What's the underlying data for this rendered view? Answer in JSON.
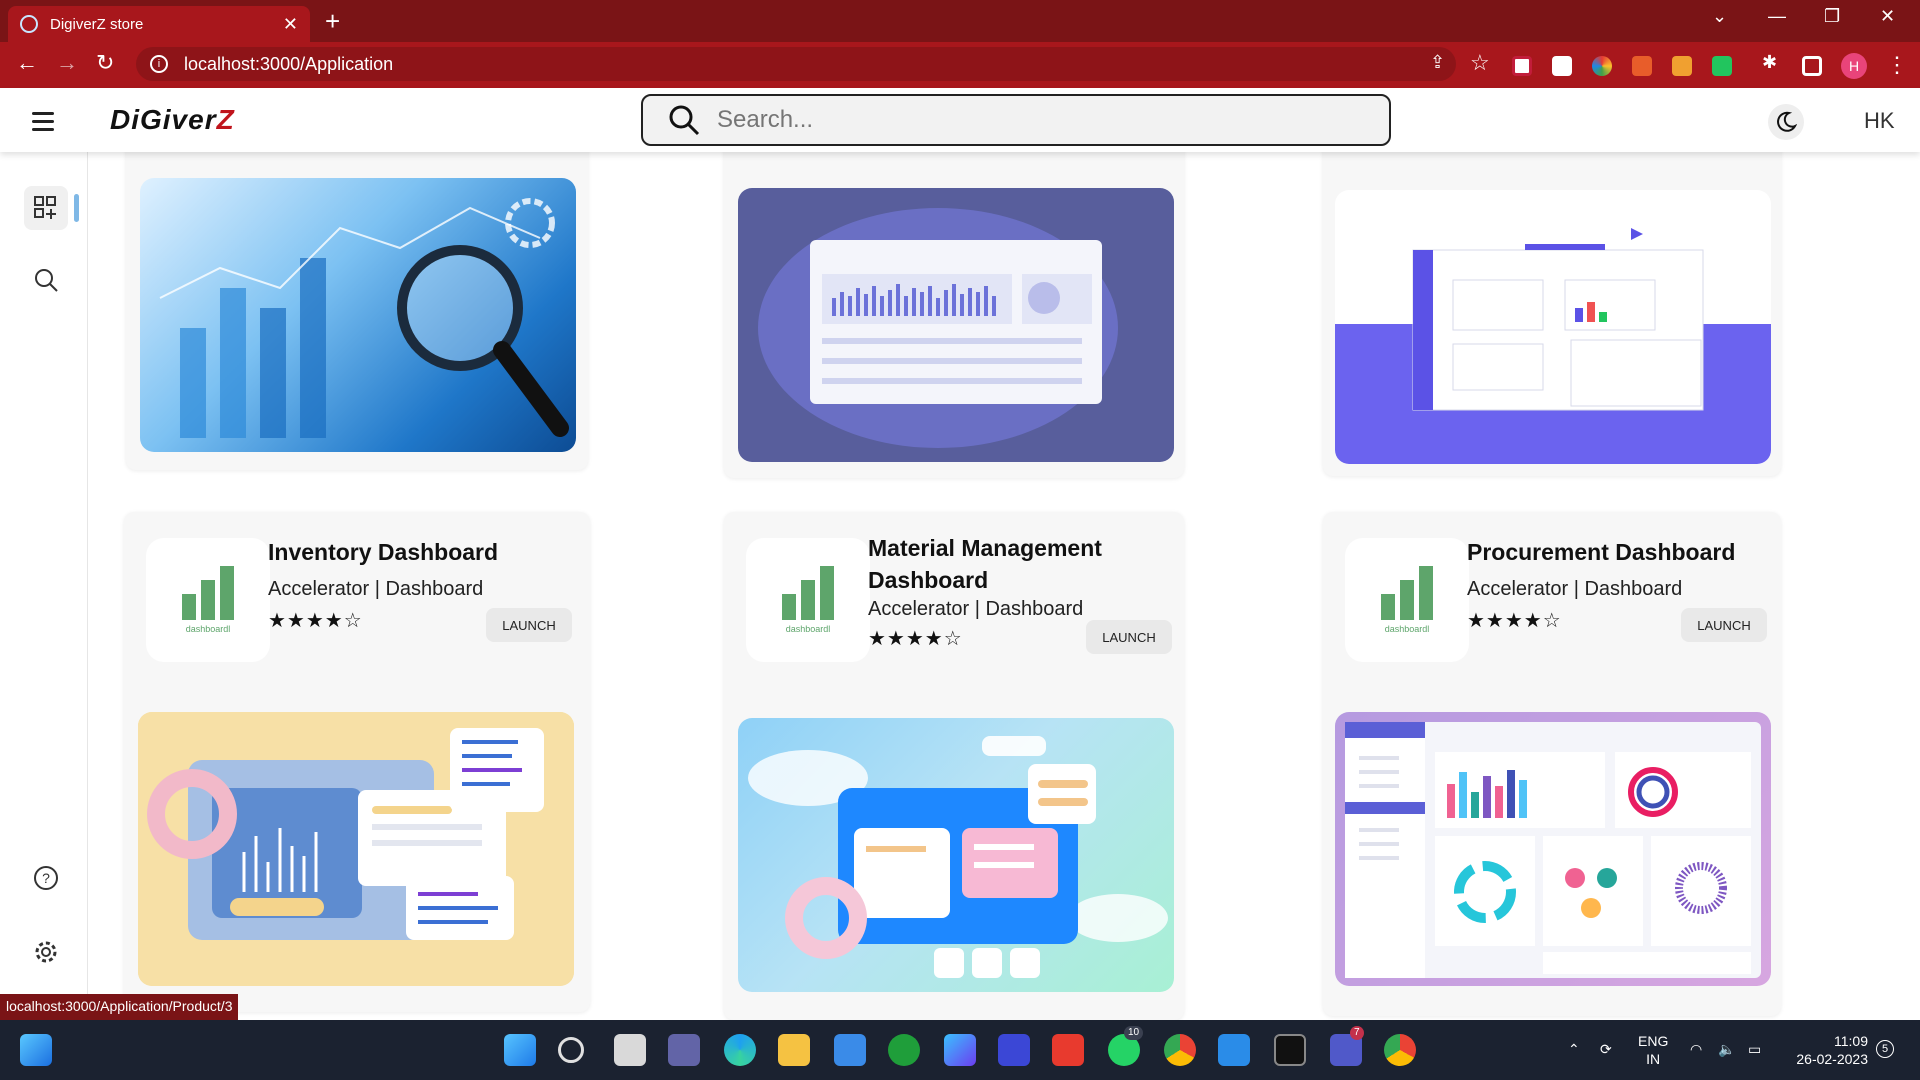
{
  "browser": {
    "tab_title": "DigiverZ store",
    "tab_close": "✕",
    "new_tab": "+",
    "url": "localhost:3000/Application",
    "profile_initial": "H",
    "status_url": "localhost:3000/Application/Product/3"
  },
  "app": {
    "logo_main": "DiGiver",
    "logo_accent": "Z",
    "search_placeholder": "Search...",
    "user_initials": "HK"
  },
  "top_row": [
    {
      "theme": "magnifier-analytics"
    },
    {
      "theme": "purple-dashboard"
    },
    {
      "theme": "workflow-diagram"
    }
  ],
  "products": [
    {
      "title": "Inventory Dashboard",
      "subtitle": "Accelerator | Dashboard",
      "rating": "★★★★☆",
      "logo_caption": "dashboardl",
      "button": "LAUNCH"
    },
    {
      "title": "Material Management Dashboard",
      "subtitle": "Accelerator | Dashboard",
      "rating": "★★★★☆",
      "logo_caption": "dashboardl",
      "button": "LAUNCH"
    },
    {
      "title": "Procurement Dashboard",
      "subtitle": "Accelerator | Dashboard",
      "rating": "★★★★☆",
      "logo_caption": "dashboardl",
      "button": "LAUNCH"
    }
  ],
  "taskbar": {
    "whatsapp_badge": "10",
    "teams_badge": "7",
    "lang_line1": "ENG",
    "lang_line2": "IN",
    "time": "11:09",
    "date": "26-02-2023",
    "notifications": "5"
  },
  "colors": {
    "chrome_dark": "#7a1416",
    "chrome": "#a8171c",
    "icon_green": "#5ea56b"
  }
}
